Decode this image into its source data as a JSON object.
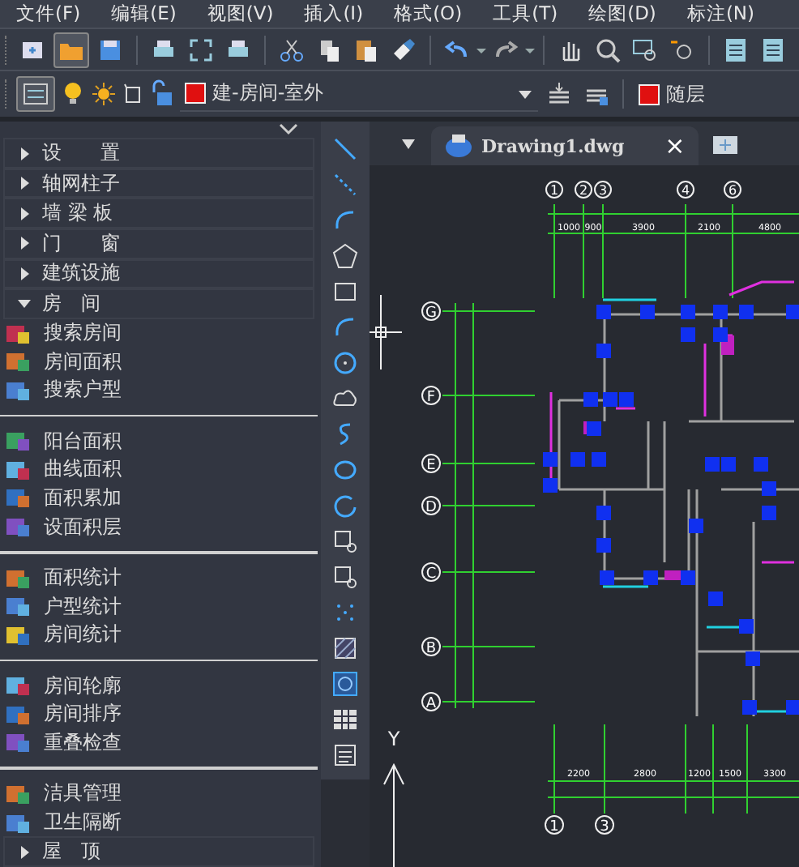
{
  "menu": [
    "文件(F)",
    "编辑(E)",
    "视图(V)",
    "插入(I)",
    "格式(O)",
    "工具(T)",
    "绘图(D)",
    "标注(N)"
  ],
  "layer": {
    "name": "建-房间-室外",
    "color": "#e01010"
  },
  "color_control": {
    "label": "随层",
    "color": "#e01010"
  },
  "panel": {
    "items": [
      {
        "kind": "header",
        "label": "设　　置",
        "expanded": false
      },
      {
        "kind": "header",
        "label": "轴网柱子",
        "expanded": false
      },
      {
        "kind": "header",
        "label": "墙 梁 板",
        "expanded": false
      },
      {
        "kind": "header",
        "label": "门　　窗",
        "expanded": false
      },
      {
        "kind": "header",
        "label": "建筑设施",
        "expanded": false
      },
      {
        "kind": "header",
        "label": "房　间",
        "expanded": true
      },
      {
        "kind": "item",
        "label": "搜索房间"
      },
      {
        "kind": "item",
        "label": "房间面积"
      },
      {
        "kind": "item",
        "label": "搜索户型"
      },
      {
        "kind": "separator"
      },
      {
        "kind": "item",
        "label": "阳台面积"
      },
      {
        "kind": "item",
        "label": "曲线面积"
      },
      {
        "kind": "item",
        "label": "面积累加"
      },
      {
        "kind": "item",
        "label": "设面积层"
      },
      {
        "kind": "separator"
      },
      {
        "kind": "item",
        "label": "面积统计"
      },
      {
        "kind": "item",
        "label": "户型统计"
      },
      {
        "kind": "item",
        "label": "房间统计"
      },
      {
        "kind": "separator"
      },
      {
        "kind": "item",
        "label": "房间轮廓"
      },
      {
        "kind": "item",
        "label": "房间排序"
      },
      {
        "kind": "item",
        "label": "重叠检查"
      },
      {
        "kind": "separator"
      },
      {
        "kind": "item",
        "label": "洁具管理"
      },
      {
        "kind": "item",
        "label": "卫生隔断"
      },
      {
        "kind": "header",
        "label": "屋　顶",
        "expanded": false
      }
    ]
  },
  "tab": {
    "title": "Drawing1.dwg",
    "close": "×"
  },
  "drawing": {
    "top_axes": [
      "1",
      "2",
      "3",
      "4",
      "6"
    ],
    "top_dims": [
      "1000",
      "900",
      "3900",
      "2100",
      "4800"
    ],
    "left_axes": [
      "G",
      "F",
      "E",
      "D",
      "C",
      "B",
      "A"
    ],
    "bottom_dims": [
      "2200",
      "2800",
      "1200",
      "1500",
      "3300"
    ],
    "bottom_axes": [
      "1",
      "3"
    ],
    "ucs_y": "Y"
  }
}
